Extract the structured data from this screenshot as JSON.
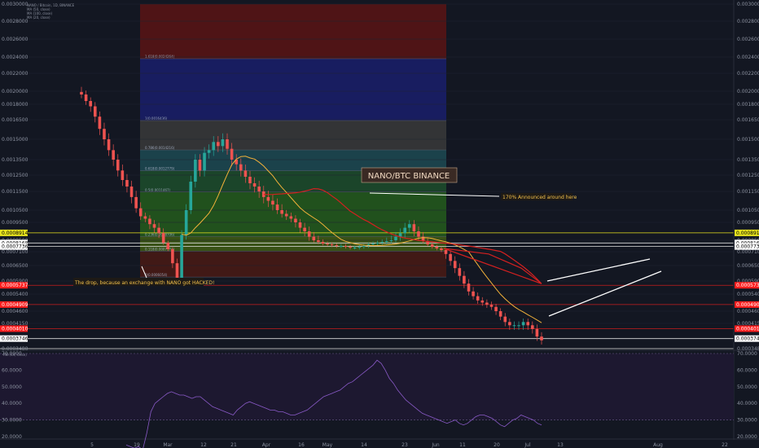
{
  "chart_data": {
    "type": "candlestick",
    "legend": [
      "NANO / Bitcoin, 1D, BINANCE",
      "MA (50, close)",
      "MA (100, close)",
      "MA (20, close)"
    ],
    "title_box": "NANO/BTC BINANCE",
    "annotations": {
      "drop": "The drop, because an exchange with NANO got HACKED!",
      "announced": "170% Announced around here"
    },
    "y_ticks": [
      "0.0030000",
      "0.0028000",
      "0.0026000",
      "0.0024000",
      "0.0022000",
      "0.0020000",
      "0.0018000",
      "0.0016500",
      "0.0015000",
      "0.0013500",
      "0.0012500",
      "0.0011500",
      "0.0010500",
      "0.0009500",
      "0.0008500",
      "0.0007100",
      "0.0006500",
      "0.0005900",
      "0.0005400",
      "0.0004600",
      "0.0004150",
      "0.0003480"
    ],
    "y_tick_values": [
      0.003,
      0.0028,
      0.0026,
      0.0024,
      0.0022,
      0.002,
      0.0018,
      0.00165,
      0.0015,
      0.00135,
      0.00125,
      0.00115,
      0.00105,
      0.00095,
      0.00085,
      0.00071,
      0.00065,
      0.00059,
      0.00054,
      0.00046,
      0.000415,
      0.000348
    ],
    "price_tags": [
      {
        "label": "0.0008914",
        "value": 0.0008914,
        "color": "#e7e31e",
        "text_color": "#000000"
      },
      {
        "label": "0.0008168",
        "value": 0.0008168,
        "color": "#ffffff",
        "text_color": "#000000"
      },
      {
        "label": "0.0007736",
        "value": 0.0007736,
        "color": "#ffffff",
        "text_color": "#000000"
      },
      {
        "label": "0.0005737",
        "value": 0.0005737,
        "color": "#ff1e1e",
        "text_color": "#ffffff"
      },
      {
        "label": "0.0004909",
        "value": 0.0004909,
        "color": "#ff1e1e",
        "text_color": "#ffffff"
      },
      {
        "label": "0.0004010",
        "value": 0.000401,
        "color": "#ff1e1e",
        "text_color": "#ffffff"
      },
      {
        "label": "0.0003746",
        "value": 0.0003746,
        "color": "#ffffff",
        "text_color": "#000000"
      }
    ],
    "price_lines": [
      {
        "value": 0.0008914,
        "color": "#e7e31e"
      },
      {
        "value": 0.0008168,
        "color": "#dddddd"
      },
      {
        "value": 0.0007736,
        "color": "#dddddd"
      },
      {
        "value": 0.0005737,
        "color": "#c81e1e"
      },
      {
        "value": 0.0004909,
        "color": "#c81e1e"
      },
      {
        "value": 0.000401,
        "color": "#c81e1e"
      },
      {
        "value": 0.0003746,
        "color": "#dddddd"
      },
      {
        "value": 0.000348,
        "color": "#dddddd"
      }
    ],
    "fib_labels": [
      "1.618(0.0024264)",
      "1(0.0016436)",
      "0.786(0.0014216)",
      "0.618(0.0012779)",
      "0.5(0.0011467)",
      "0.236(0.0008706)",
      "0.118(0.0007174)",
      "0(0.0006054)"
    ],
    "fib_levels": [
      {
        "value": 0.003,
        "color": "#5a1414",
        "label": ""
      },
      {
        "value": 0.0023795,
        "color": "#1a1f6b",
        "label": "1.618(0.0024264)"
      },
      {
        "value": 0.0016436,
        "color": "#3a3a3a",
        "label": "1(0.0016436)"
      },
      {
        "value": 0.0014216,
        "color": "#1d4a52",
        "label": "0.786(0.0014216)"
      },
      {
        "value": 0.0012779,
        "color": "#1d4d2c",
        "label": "0.618(0.0012779)"
      },
      {
        "value": 0.0011467,
        "color": "#245c1c",
        "label": "0.5(0.0011467)"
      },
      {
        "value": 0.0008706,
        "color": "#3f5c14",
        "label": "0.236(0.0008706)"
      },
      {
        "value": 0.0007174,
        "color": "#4a1a14",
        "label": "0.118(0.0007174)"
      },
      {
        "value": 0.0006054,
        "color": "#4a1a14",
        "label": "0(0.0006054)"
      }
    ],
    "x_ticks": [
      "5",
      "19",
      "Mar",
      "12",
      "21",
      "Apr",
      "16",
      "May",
      "14",
      "23",
      "Jun",
      "11",
      "20",
      "Jul",
      "13",
      "Aug",
      "22"
    ],
    "rsi": {
      "label": "RSI (14, close)",
      "y_ticks": [
        "70.0000",
        "60.0000",
        "50.0000",
        "40.0000",
        "30.0000",
        "20.0000"
      ],
      "y_tick_values": [
        70,
        60,
        50,
        40,
        30,
        20
      ],
      "values": [
        15,
        14,
        13,
        14,
        12,
        22,
        35,
        40,
        42,
        44,
        46,
        47,
        46,
        45,
        45,
        44,
        43,
        44,
        44,
        42,
        40,
        38,
        37,
        36,
        35,
        34,
        33,
        36,
        38,
        40,
        41,
        40,
        39,
        38,
        37,
        36,
        36,
        35,
        35,
        34,
        33,
        33,
        34,
        35,
        36,
        38,
        40,
        42,
        44,
        45,
        46,
        47,
        48,
        50,
        52,
        53,
        55,
        57,
        59,
        61,
        63,
        66,
        64,
        60,
        55,
        52,
        48,
        45,
        42,
        40,
        38,
        36,
        34,
        33,
        32,
        31,
        30,
        29,
        28,
        29,
        30,
        28,
        27,
        28,
        30,
        32,
        33,
        33,
        32,
        31,
        29,
        27,
        26,
        28,
        30,
        31,
        33,
        32,
        31,
        30,
        28,
        27
      ]
    },
    "close": [
      0.00195,
      0.00185,
      0.00178,
      0.00168,
      0.00158,
      0.0015,
      0.00142,
      0.00135,
      0.00128,
      0.00122,
      0.00118,
      0.00112,
      0.00106,
      0.001,
      0.00098,
      0.00094,
      0.00092,
      0.00089,
      0.00082,
      0.00074,
      0.00066,
      0.0006,
      0.00088,
      0.00105,
      0.00121,
      0.00135,
      0.00128,
      0.0014,
      0.00142,
      0.00148,
      0.00145,
      0.0015,
      0.00143,
      0.00135,
      0.00132,
      0.00128,
      0.00124,
      0.0012,
      0.00118,
      0.00115,
      0.00112,
      0.0011,
      0.00108,
      0.00105,
      0.00102,
      0.001,
      0.00098,
      0.00095,
      0.00092,
      0.0009,
      0.00087,
      0.00085,
      0.00083,
      0.00081,
      0.0008,
      0.00079,
      0.00078,
      0.00078,
      0.00077,
      0.00076,
      0.00076,
      0.00077,
      0.00078,
      0.0008,
      0.00081,
      0.00082,
      0.00083,
      0.00084,
      0.00085,
      0.00087,
      0.00089,
      0.00092,
      0.00094,
      0.0009,
      0.00087,
      0.00084,
      0.0008,
      0.00077,
      0.00075,
      0.00073,
      0.0007,
      0.00067,
      0.00064,
      0.00061,
      0.00058,
      0.00055,
      0.00053,
      0.00051,
      0.0005,
      0.00049,
      0.00048,
      0.00046,
      0.00044,
      0.00042,
      0.00041,
      0.00041,
      0.00041,
      0.00042,
      0.00041,
      0.0004,
      0.00038,
      0.00037
    ]
  }
}
